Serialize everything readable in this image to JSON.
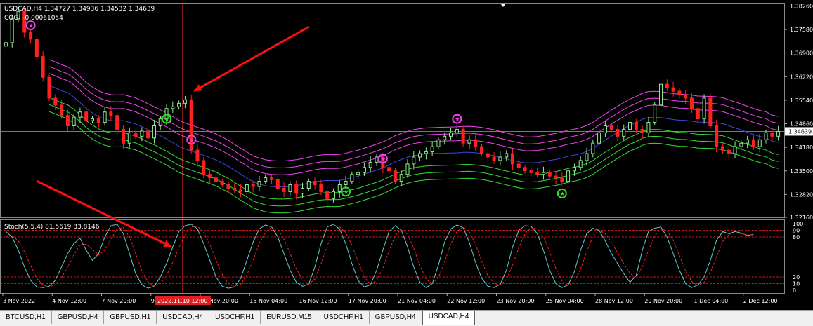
{
  "main_header": {
    "symbol_line": "USDCAD,H4  1.34727 1.34936 1.34532 1.34639",
    "cog_line": "COG: -0.00061054"
  },
  "stoch_header": "Stoch(5,5,4) 81.5619 83.8146",
  "colors": {
    "background": "#000000",
    "bull_candle": "#90ee90",
    "bear_candle": "#ff2020",
    "upper_band": "#ee44ee",
    "lower_band": "#33dd33",
    "center_line": "#4444dd",
    "stoch_main": "#66cccc",
    "stoch_signal": "#ff2020",
    "arrow": "#ff1010",
    "crosshair": "#ff3030"
  },
  "chart_data": [
    {
      "type": "candlestick",
      "price_axis_labels": [
        "1.38260",
        "1.37580",
        "1.36900",
        "1.36220",
        "1.35540",
        "1.34860",
        "1.34180",
        "1.33500",
        "1.32820",
        "1.32160"
      ],
      "current_price_label": "1.34639",
      "ylim": [
        1.3216,
        1.3835
      ],
      "time_labels": [
        "3 Nov 2022",
        "4 Nov 12:00",
        "7 Nov 20:00",
        "9 Nov 04:00",
        "11 Nov 20:00",
        "15 Nov 04:00",
        "16 Nov 12:00",
        "17 Nov 20:00",
        "21 Nov 04:00",
        "22 Nov 12:00",
        "23 Nov 20:00",
        "25 Nov 04:00",
        "28 Nov 12:00",
        "29 Nov 20:00",
        "1 Dec 04:00",
        "2 Dec 12:00"
      ],
      "crosshair_time_label": "2022.11.10 12:00",
      "close": [
        1.372,
        1.379,
        1.381,
        1.375,
        1.373,
        1.368,
        1.362,
        1.356,
        1.354,
        1.351,
        1.348,
        1.3505,
        1.352,
        1.3495,
        1.35,
        1.349,
        1.352,
        1.351,
        1.347,
        1.343,
        1.346,
        1.345,
        1.3465,
        1.3445,
        1.348,
        1.35,
        1.353,
        1.3535,
        1.3545,
        1.3555,
        1.341,
        1.338,
        1.334,
        1.333,
        1.332,
        1.331,
        1.33,
        1.3295,
        1.329,
        1.331,
        1.3305,
        1.332,
        1.333,
        1.3325,
        1.33,
        1.329,
        1.331,
        1.3285,
        1.33,
        1.332,
        1.331,
        1.329,
        1.327,
        1.329,
        1.331,
        1.332,
        1.334,
        1.3345,
        1.336,
        1.3375,
        1.339,
        1.336,
        1.335,
        1.332,
        1.334,
        1.337,
        1.339,
        1.34,
        1.3405,
        1.342,
        1.344,
        1.345,
        1.346,
        1.347,
        1.343,
        1.344,
        1.342,
        1.34,
        1.339,
        1.338,
        1.339,
        1.34,
        1.337,
        1.336,
        1.335,
        1.3345,
        1.334,
        1.3345,
        1.3335,
        1.333,
        1.332,
        1.335,
        1.336,
        1.338,
        1.34,
        1.343,
        1.346,
        1.348,
        1.347,
        1.345,
        1.347,
        1.349,
        1.347,
        1.346,
        1.349,
        1.354,
        1.36,
        1.359,
        1.358,
        1.357,
        1.356,
        1.353,
        1.35,
        1.356,
        1.348,
        1.342,
        1.341,
        1.34,
        1.342,
        1.343,
        1.344,
        1.342,
        1.344,
        1.346,
        1.345,
        1.3464
      ],
      "stochastic": {
        "ylim": [
          0,
          100
        ],
        "level_labels": [
          "100",
          "90",
          "80",
          "20",
          "10",
          "0"
        ],
        "levels": [
          90,
          80,
          20,
          10
        ],
        "main": [
          88,
          80,
          60,
          35,
          15,
          5,
          4,
          6,
          15,
          35,
          55,
          70,
          78,
          60,
          45,
          55,
          80,
          97,
          99,
          85,
          55,
          25,
          8,
          3,
          6,
          20,
          40,
          65,
          88,
          97,
          99,
          92,
          70,
          45,
          20,
          6,
          3,
          5,
          18,
          45,
          72,
          92,
          98,
          95,
          80,
          55,
          30,
          12,
          6,
          9,
          35,
          70,
          95,
          99,
          92,
          70,
          40,
          15,
          5,
          8,
          30,
          60,
          88,
          97,
          90,
          65,
          35,
          12,
          4,
          10,
          38,
          72,
          92,
          98,
          94,
          72,
          42,
          18,
          6,
          4,
          9,
          30,
          65,
          90,
          97,
          96,
          85,
          60,
          30,
          10,
          4,
          8,
          28,
          60,
          85,
          93,
          90,
          74,
          55,
          40,
          25,
          12,
          22,
          60,
          88,
          93,
          95,
          80,
          55,
          30,
          10,
          4,
          8,
          20,
          45,
          75,
          88,
          85,
          88,
          86,
          82,
          84
        ],
        "signal": [
          80,
          82,
          74,
          58,
          37,
          18,
          8,
          5,
          8,
          19,
          35,
          53,
          68,
          69,
          61,
          53,
          60,
          77,
          92,
          94,
          80,
          55,
          29,
          12,
          6,
          10,
          22,
          42,
          64,
          83,
          95,
          96,
          87,
          69,
          45,
          24,
          10,
          5,
          9,
          23,
          45,
          70,
          87,
          95,
          91,
          77,
          55,
          32,
          16,
          9,
          17,
          40,
          67,
          88,
          95,
          87,
          68,
          43,
          20,
          9,
          15,
          33,
          59,
          82,
          92,
          84,
          63,
          37,
          17,
          9,
          19,
          43,
          69,
          88,
          95,
          88,
          69,
          44,
          22,
          10,
          8,
          16,
          38,
          64,
          85,
          94,
          92,
          80,
          58,
          33,
          14,
          7,
          12,
          32,
          58,
          81,
          90,
          85,
          72,
          56,
          40,
          25,
          20,
          35,
          60,
          82,
          92,
          89,
          75,
          52,
          29,
          13,
          7,
          12,
          27,
          50,
          73,
          84,
          86,
          85,
          83,
          83
        ]
      }
    }
  ],
  "tabs": [
    {
      "label": "BTCUSD,H1",
      "active": false
    },
    {
      "label": "GBPUSD,H4",
      "active": false
    },
    {
      "label": "GBPUSD,H1",
      "active": false
    },
    {
      "label": "USDCAD,H4",
      "active": false
    },
    {
      "label": "USDCHF,H1",
      "active": false
    },
    {
      "label": "EURUSD,M15",
      "active": false
    },
    {
      "label": "USDCHF,H1",
      "active": false
    },
    {
      "label": "GBPUSD,H4",
      "active": false
    },
    {
      "label": "USDCAD,H4",
      "active": true
    }
  ]
}
